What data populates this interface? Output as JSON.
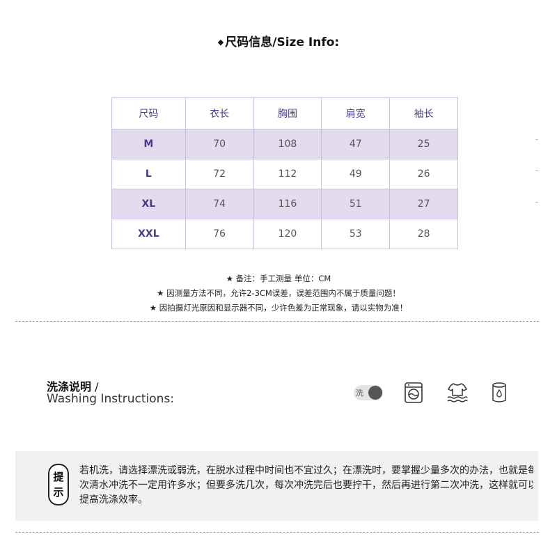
{
  "title": "尺码信息/Size Info:",
  "title_marker": "◆",
  "size_table": {
    "headers": [
      "尺码",
      "衣长",
      "胸围",
      "肩宽",
      "袖长"
    ],
    "rows": [
      [
        "M",
        "70",
        "108",
        "47",
        "25"
      ],
      [
        "L",
        "72",
        "112",
        "49",
        "26"
      ],
      [
        "XL",
        "74",
        "116",
        "51",
        "27"
      ],
      [
        "XXL",
        "76",
        "120",
        "53",
        "28"
      ]
    ]
  },
  "notes": [
    "★ 备注：手工测量 单位：CM",
    "★ 因测量方法不同，允许2-3CM误差，误差范围内不属于质量问题！",
    "★ 因拍摄灯光原因和显示器不同，少许色差为正常现象，请以实物为准！"
  ],
  "washing": {
    "title": "洗涤说明",
    "slash": " /",
    "subtitle": "Washing Instructions:",
    "toggle_label": "洗",
    "icons": [
      "hand-wash-toggle-icon",
      "washing-machine-icon",
      "shirt-wash-icon",
      "bleach-container-icon"
    ]
  },
  "tip": {
    "badge_chars": [
      "提",
      "示"
    ],
    "lines": [
      "若机洗，请选择漂洗或弱洗，在脱水过程中时间也不宜过久；在漂洗时，要掌握少量多次的办法，也就是每",
      "次清水冲洗不一定用许多水；但要多洗几次，每次冲洗完后也要拧干，然后再进行第二次冲洗，这样就可以",
      "提高洗涤效率。"
    ]
  },
  "colors": {
    "header_text": "#4b3a8a",
    "row_shade": "#e3dcef",
    "border": "#c9c0de",
    "tip_background": "#f1f1f1"
  }
}
